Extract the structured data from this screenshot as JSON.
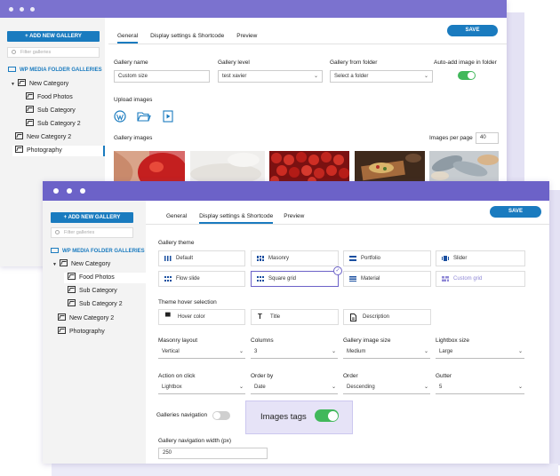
{
  "back_window": {
    "sidebar": {
      "add_button": "+ ADD NEW GALLERY",
      "filter_placeholder": "Filter galleries",
      "root_label": "WP MEDIA FOLDER GALLERIES",
      "tree": [
        "New Category",
        "Food Photos",
        "Sub Category",
        "Sub Category 2",
        "New Category 2",
        "Photography"
      ]
    },
    "tabs": [
      "General",
      "Display settings & Shortcode",
      "Preview"
    ],
    "active_tab": "General",
    "save_label": "SAVE",
    "gallery_name": {
      "label": "Gallery name",
      "value": "Custom size"
    },
    "gallery_level": {
      "label": "Gallery level",
      "value": "test xavier"
    },
    "gallery_from_folder": {
      "label": "Gallery from folder",
      "value": "Select a folder"
    },
    "auto_add": {
      "label": "Auto-add image in folder",
      "enabled": true
    },
    "upload_label": "Upload images",
    "upload_icons": [
      "wordpress-icon",
      "folder-open-icon",
      "video-icon"
    ],
    "gallery_images_label": "Gallery images",
    "images_per_page": {
      "label": "Images per page",
      "value": "40"
    },
    "thumbnails": [
      "strawberry-photo",
      "bread-photo",
      "cherry-tomatoes-photo",
      "pizza-board-photo",
      "grilled-fish-photo"
    ]
  },
  "front_window": {
    "sidebar": {
      "add_button": "+ ADD NEW GALLERY",
      "filter_placeholder": "Filter galleries",
      "root_label": "WP MEDIA FOLDER GALLERIES",
      "tree": [
        "New Category",
        "Food Photos",
        "Sub Category",
        "Sub Category 2",
        "New Category 2",
        "Photography"
      ]
    },
    "tabs": [
      "General",
      "Display settings & Shortcode",
      "Preview"
    ],
    "active_tab": "Display settings & Shortcode",
    "save_label": "SAVE",
    "gallery_theme": {
      "label": "Gallery theme",
      "options": [
        "Default",
        "Masonry",
        "Portfolio",
        "Slider",
        "Flow slide",
        "Square grid",
        "Material",
        "Custom grid"
      ],
      "selected": "Square grid"
    },
    "theme_hover": {
      "label": "Theme hover selection",
      "options": [
        "Hover color",
        "Title",
        "Description"
      ]
    },
    "selects_row1": [
      {
        "label": "Masonry layout",
        "value": "Vertical"
      },
      {
        "label": "Columns",
        "value": "3"
      },
      {
        "label": "Gallery image size",
        "value": "Medium"
      },
      {
        "label": "Lightbox size",
        "value": "Large"
      }
    ],
    "selects_row2": [
      {
        "label": "Action on click",
        "value": "Lightbox"
      },
      {
        "label": "Order by",
        "value": "Date"
      },
      {
        "label": "Order",
        "value": "Descending"
      },
      {
        "label": "Gutter",
        "value": "5"
      }
    ],
    "galleries_navigation": {
      "label": "Galleries navigation",
      "enabled": false
    },
    "images_tags": {
      "label": "Images tags",
      "enabled": true
    },
    "nav_width": {
      "label": "Gallery navigation width (px)",
      "value": "250"
    }
  },
  "colors": {
    "accent": "#1a7bbf",
    "titlebar": "#6c62c8",
    "toggle_on": "#41b85b",
    "highlight": "#e6e3f7"
  }
}
